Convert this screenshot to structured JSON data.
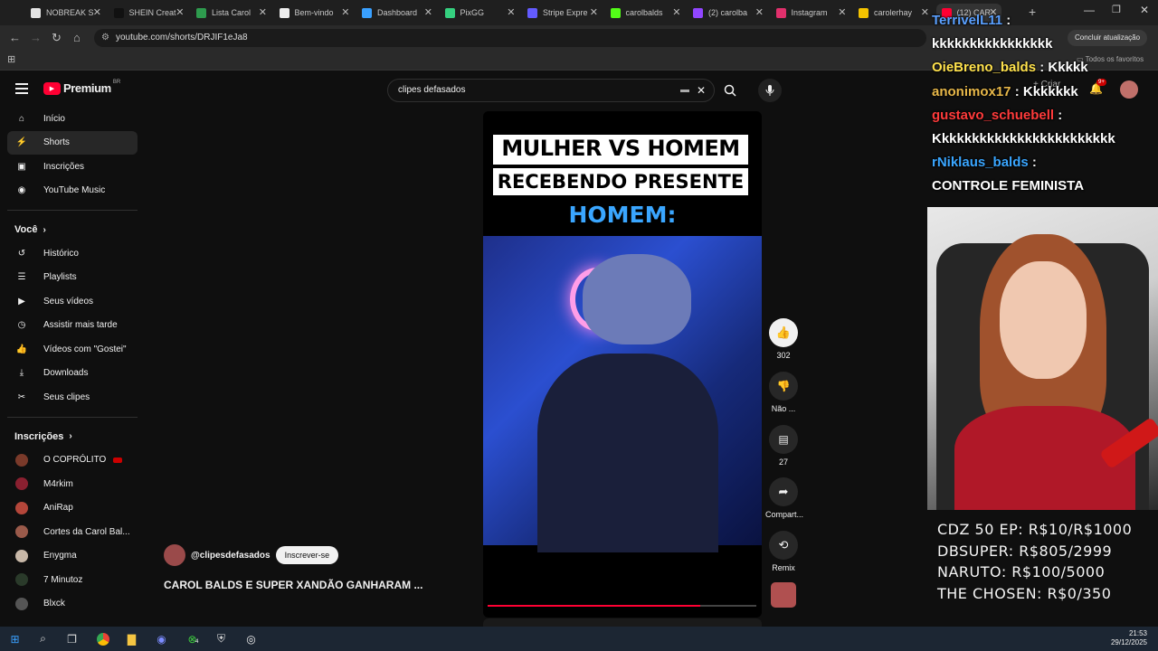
{
  "browser": {
    "tabs": [
      {
        "label": "NOBREAK S",
        "color": "#e4e4e4"
      },
      {
        "label": "SHEIN Creat",
        "color": "#111111"
      },
      {
        "label": "Lista Carol",
        "color": "#2e9b4e"
      },
      {
        "label": "Bem-vindo",
        "color": "#eeeeee"
      },
      {
        "label": "Dashboard",
        "color": "#39a0ff"
      },
      {
        "label": "PixGG",
        "color": "#35d07f"
      },
      {
        "label": "Stripe Expre",
        "color": "#635bff"
      },
      {
        "label": "carolbalds",
        "color": "#53fc18"
      },
      {
        "label": "(2) carolba",
        "color": "#9146ff"
      },
      {
        "label": "Instagram",
        "color": "#e1306c"
      },
      {
        "label": "carolerhay",
        "color": "#f5c400"
      },
      {
        "label": "(12) CAR",
        "color": "#ff0033"
      }
    ],
    "url": "youtube.com/shorts/DRJIF1eJa8",
    "update_button": "Concluir atualização",
    "favorites_label": "Todos os favoritos"
  },
  "youtube": {
    "logo": "Premium",
    "logo_badge": "BR",
    "search_value": "clipes defasados",
    "nav": [
      {
        "label": "Início",
        "icon": "home-icon"
      },
      {
        "label": "Shorts",
        "icon": "shorts-icon"
      },
      {
        "label": "Inscrições",
        "icon": "subscriptions-icon"
      },
      {
        "label": "YouTube Music",
        "icon": "music-icon"
      }
    ],
    "you_heading": "Você",
    "you_items": [
      {
        "label": "Histórico",
        "icon": "history-icon"
      },
      {
        "label": "Playlists",
        "icon": "playlists-icon"
      },
      {
        "label": "Seus vídeos",
        "icon": "your-videos-icon"
      },
      {
        "label": "Assistir mais tarde",
        "icon": "watch-later-icon"
      },
      {
        "label": "Vídeos com \"Gostei\"",
        "icon": "liked-icon"
      },
      {
        "label": "Downloads",
        "icon": "download-icon"
      },
      {
        "label": "Seus clipes",
        "icon": "clips-icon"
      }
    ],
    "subs_heading": "Inscrições",
    "subscriptions": [
      {
        "label": "O COPRÓLITO",
        "color": "#7a3a2a"
      },
      {
        "label": "M4rkim",
        "color": "#8a2030"
      },
      {
        "label": "AniRap",
        "color": "#b4463a"
      },
      {
        "label": "Cortes da Carol Bal...",
        "color": "#9a5a4a"
      },
      {
        "label": "Enygma",
        "color": "#c8b8a8"
      },
      {
        "label": "7 Minutoz",
        "color": "#2a3a2a"
      },
      {
        "label": "Blxck",
        "color": "#555555"
      }
    ],
    "short": {
      "title_line1": "MULHER VS HOMEM",
      "title_line2": "RECEBENDO PRESENTE",
      "caption": "HOMEM:",
      "channel": "@clipesdefasados",
      "subscribe": "Inscrever-se",
      "video_title": "CAROL BALDS E SUPER XANDÃO GANHARAM ...",
      "progress": 0.79
    },
    "actions": {
      "like_count": "302",
      "dislike_label": "Não ...",
      "comment_count": "27",
      "share_label": "Compart...",
      "remix_label": "Remix"
    },
    "notif_badge": "9+"
  },
  "stream_overlay": {
    "chat": [
      {
        "user": "TerrivelL11",
        "msg": "kkkkkkkkkkkkkkkk",
        "color": "#5aa0ff"
      },
      {
        "user": "OieBreno_balds",
        "msg": "Kkkkk",
        "color": "#ffe24d"
      },
      {
        "user": "anonimox17",
        "msg": "Kkkkkkk",
        "color": "#e8b84a"
      },
      {
        "user": "gustavo_schuebell",
        "msg": "Kkkkkkkkkkkkkkkkkkkkkkkk",
        "color": "#ff3b3b"
      },
      {
        "user": "rNiklaus_balds",
        "msg": "CONTROLE FEMINISTA",
        "color": "#3aa6ff"
      }
    ],
    "goals": [
      "CDZ 50 EP: R$10/R$1000",
      "DBSUPER: R$805/2999",
      "NARUTO: R$100/5000",
      "THE CHOSEN: R$0/350"
    ]
  },
  "taskbar": {
    "time": "21:53",
    "date": "29/12/2025",
    "xbox_badge": "4"
  }
}
